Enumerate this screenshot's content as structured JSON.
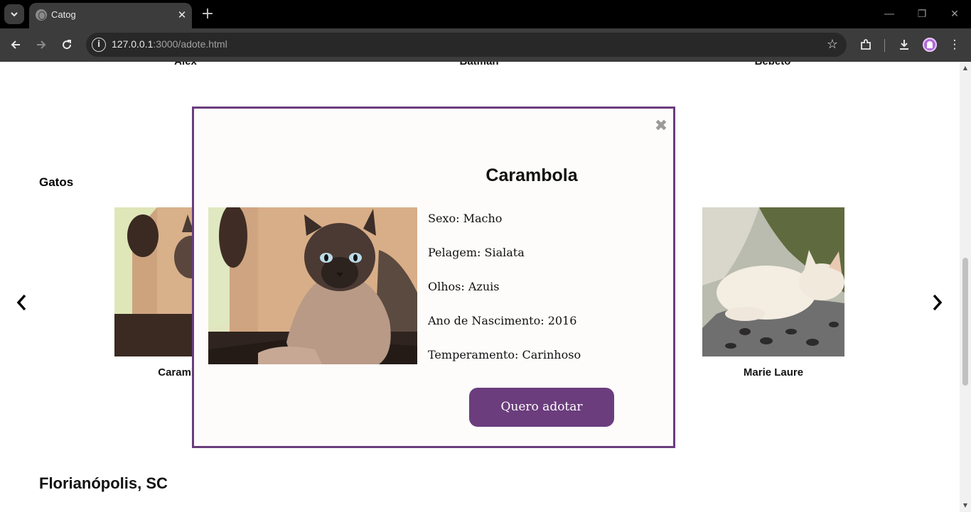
{
  "browser": {
    "tab_title": "Catog",
    "url_host": "127.0.0.1",
    "url_path": ":3000/adote.html"
  },
  "page": {
    "top_row_names": [
      "Alex",
      "Batman",
      "Bebeto"
    ],
    "section_title": "Gatos",
    "cats": [
      {
        "name": "Carambola"
      },
      {
        "name": "Marie Laure"
      }
    ],
    "city": "Florianópolis, SC"
  },
  "modal": {
    "close_glyph": "✖",
    "title": "Carambola",
    "attributes": [
      "Sexo: Macho",
      "Pelagem: Sialata",
      "Olhos: Azuis",
      "Ano de Nascimento: 2016",
      "Temperamento: Carinhoso"
    ],
    "adopt_button": "Quero adotar"
  },
  "colors": {
    "accent": "#6b3d7d",
    "modal_background": "#fdfcfb",
    "chrome_dark": "#3c3c3c"
  },
  "icons": {
    "tab_list": "chevron-down-icon",
    "back": "arrow-left-icon",
    "forward": "arrow-right-icon",
    "reload": "reload-icon",
    "site_info": "info-icon",
    "bookmark": "star-icon",
    "extensions": "puzzle-icon",
    "downloads": "download-icon",
    "menu": "kebab-menu-icon",
    "carousel_prev": "chevron-left-icon",
    "carousel_next": "chevron-right-icon"
  }
}
